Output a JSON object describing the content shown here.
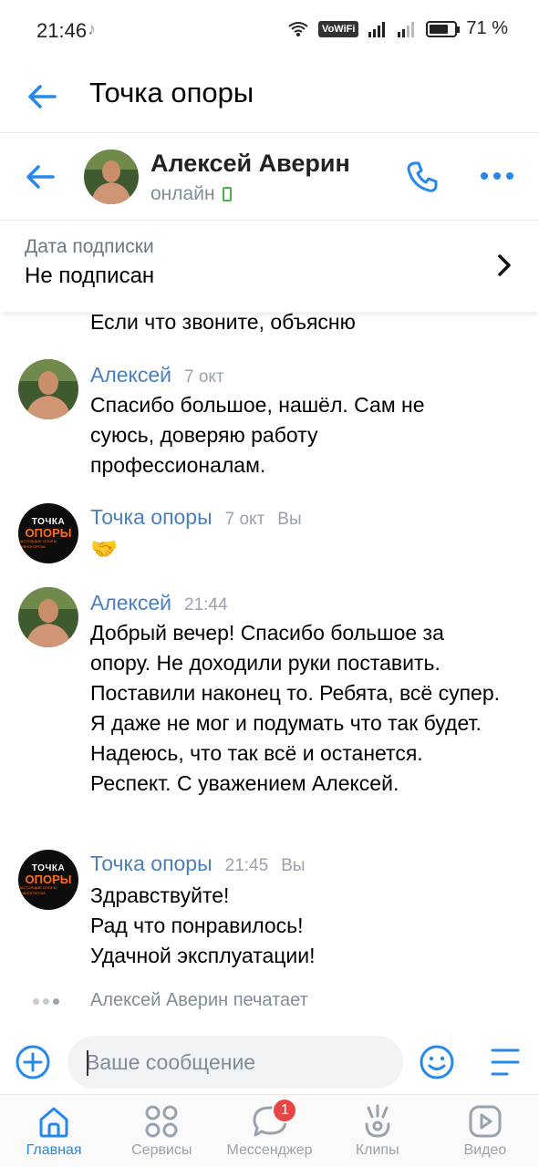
{
  "status_bar": {
    "time": "21:46",
    "battery": "71 %",
    "vowifi": "VoWiFi"
  },
  "header": {
    "title": "Точка опоры"
  },
  "chat": {
    "name": "Алексей Аверин",
    "status": "онлайн"
  },
  "subscription": {
    "label": "Дата подписки",
    "value": "Не подписан"
  },
  "messages": {
    "partial": "Если что звоните, объясню",
    "m1": {
      "author": "Алексей",
      "time": "7 окт",
      "text": "Спасибо большое, нашёл. Сам не суюсь, доверяю работу профессионалам."
    },
    "m2": {
      "author": "Точка опоры",
      "time": "7 окт",
      "you": "Вы",
      "text": "🤝"
    },
    "m3": {
      "author": "Алексей",
      "time": "21:44",
      "text": "Добрый вечер! Спасибо большое за опору. Не доходили руки поставить. Поставили наконец то. Ребята, всё супер. Я даже не мог и подумать что так будет. Надеюсь, что так всё и останется. Респект. С уважением Алексей."
    },
    "m4": {
      "author": "Точка опоры",
      "time": "21:45",
      "you": "Вы",
      "lines": [
        "Здравствуйте!",
        "Рад что понравилось!",
        "Удачной эксплуатации!"
      ]
    }
  },
  "brand_avatar": {
    "line1": "ТОЧКА",
    "line2": "ОПОРЫ",
    "line3": "НАСТОЯЩИЕ ОПОРЫ ДИВНОГОРСКА"
  },
  "typing": "Алексей Аверин печатает",
  "composer": {
    "placeholder": "Ваше сообщение"
  },
  "tabs": [
    {
      "label": "Главная",
      "icon": "home-icon"
    },
    {
      "label": "Сервисы",
      "icon": "services-icon"
    },
    {
      "label": "Мессенджер",
      "icon": "messenger-icon",
      "badge": "1"
    },
    {
      "label": "Клипы",
      "icon": "clips-icon"
    },
    {
      "label": "Видео",
      "icon": "video-icon"
    }
  ],
  "colors": {
    "accent": "#2688eb",
    "author": "#4a7fbf",
    "badge": "#e64646"
  }
}
